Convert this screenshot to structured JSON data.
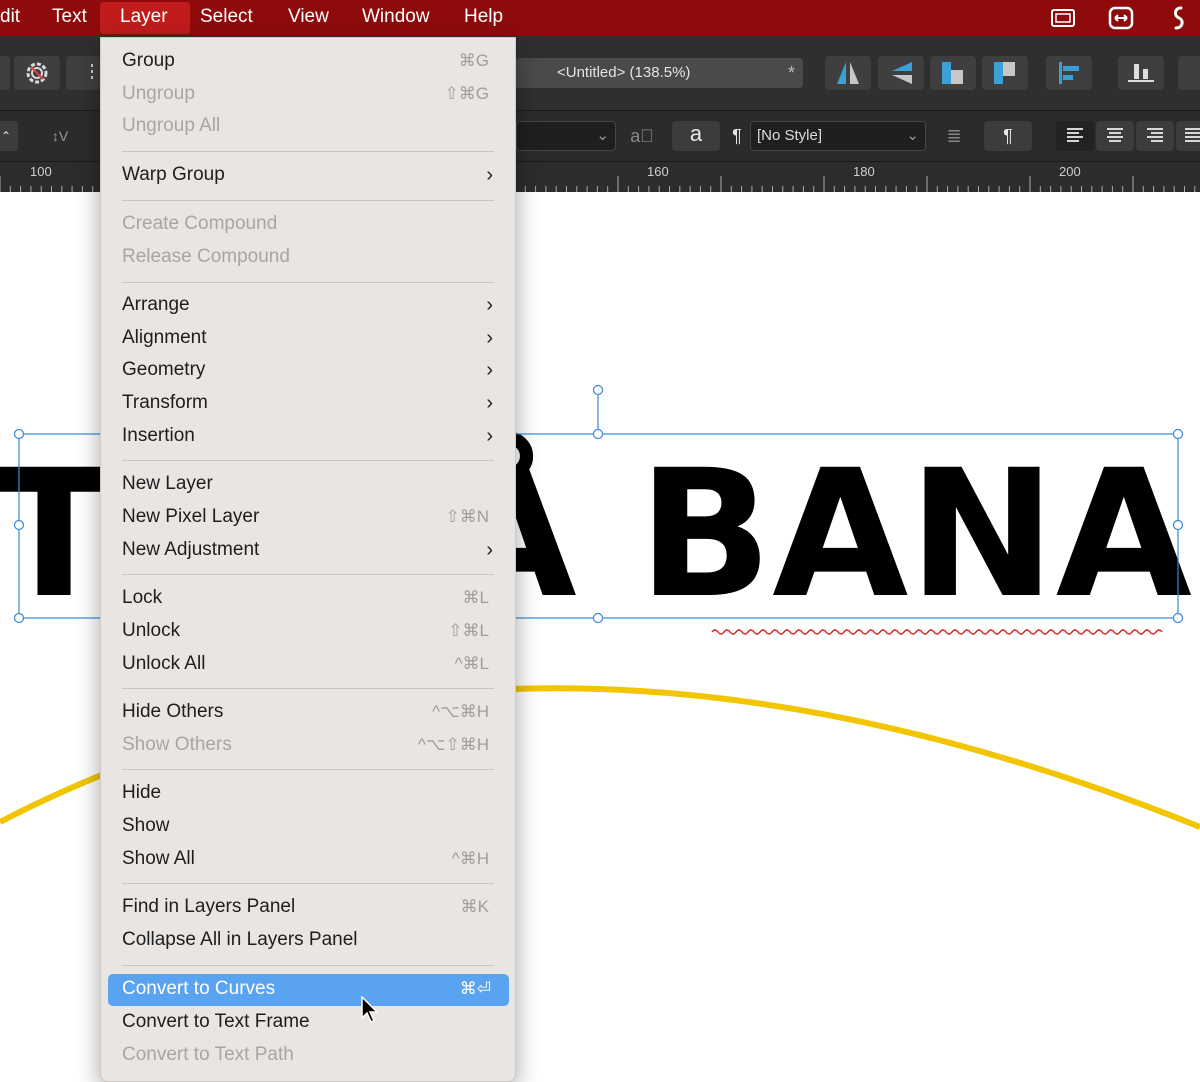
{
  "menubar": {
    "items": [
      {
        "label": "dit"
      },
      {
        "label": "Text"
      },
      {
        "label": "Layer"
      },
      {
        "label": "Select"
      },
      {
        "label": "View"
      },
      {
        "label": "Window"
      },
      {
        "label": "Help"
      }
    ],
    "active_index": 2,
    "right_icons": [
      "window-frame-icon",
      "swap-arrows-icon",
      "app-logo-icon"
    ],
    "bg_color": "#8f0b0b",
    "active_color": "#c01c1c"
  },
  "toolbar": {
    "document_title": "<Untitled> (138.5%)",
    "modified_marker": "*"
  },
  "contextbar": {
    "char_style_button": "a",
    "pilcrow": "¶",
    "paragraph_style": "[No Style]"
  },
  "ruler": {
    "labels": [
      "100",
      "160",
      "180",
      "200"
    ]
  },
  "canvas": {
    "text": "TÅ PÅ BANA",
    "curve_color": "#f2c500",
    "selection_color": "#3c86d8"
  },
  "menu": {
    "items": [
      {
        "label": "Group",
        "shortcut": "⌘G",
        "state": "enabled"
      },
      {
        "label": "Ungroup",
        "shortcut": "⇧⌘G",
        "state": "disabled"
      },
      {
        "label": "Ungroup All",
        "shortcut": "",
        "state": "disabled"
      },
      {
        "label": "Warp Group",
        "shortcut": "",
        "state": "enabled",
        "submenu": true
      },
      {
        "label": "Create Compound",
        "shortcut": "",
        "state": "disabled"
      },
      {
        "label": "Release Compound",
        "shortcut": "",
        "state": "disabled"
      },
      {
        "label": "Arrange",
        "shortcut": "",
        "state": "enabled",
        "submenu": true
      },
      {
        "label": "Alignment",
        "shortcut": "",
        "state": "enabled",
        "submenu": true
      },
      {
        "label": "Geometry",
        "shortcut": "",
        "state": "enabled",
        "submenu": true
      },
      {
        "label": "Transform",
        "shortcut": "",
        "state": "enabled",
        "submenu": true
      },
      {
        "label": "Insertion",
        "shortcut": "",
        "state": "enabled",
        "submenu": true
      },
      {
        "label": "New Layer",
        "shortcut": "",
        "state": "enabled"
      },
      {
        "label": "New Pixel Layer",
        "shortcut": "⇧⌘N",
        "state": "enabled"
      },
      {
        "label": "New Adjustment",
        "shortcut": "",
        "state": "enabled",
        "submenu": true
      },
      {
        "label": "Lock",
        "shortcut": "⌘L",
        "state": "enabled"
      },
      {
        "label": "Unlock",
        "shortcut": "⇧⌘L",
        "state": "enabled"
      },
      {
        "label": "Unlock All",
        "shortcut": "^⌘L",
        "state": "enabled"
      },
      {
        "label": "Hide Others",
        "shortcut": "^⌥⌘H",
        "state": "enabled"
      },
      {
        "label": "Show Others",
        "shortcut": "^⌥⇧⌘H",
        "state": "disabled"
      },
      {
        "label": "Hide",
        "shortcut": "",
        "state": "enabled"
      },
      {
        "label": "Show",
        "shortcut": "",
        "state": "enabled"
      },
      {
        "label": "Show All",
        "shortcut": "^⌘H",
        "state": "enabled"
      },
      {
        "label": "Find in Layers Panel",
        "shortcut": "⌘K",
        "state": "enabled"
      },
      {
        "label": "Collapse All in Layers Panel",
        "shortcut": "",
        "state": "enabled"
      },
      {
        "label": "Convert to Curves",
        "shortcut": "⌘⏎",
        "state": "selected"
      },
      {
        "label": "Convert to Text Frame",
        "shortcut": "",
        "state": "enabled"
      },
      {
        "label": "Convert to Text Path",
        "shortcut": "",
        "state": "disabled"
      }
    ],
    "highlight_color": "#5aa3f0"
  }
}
